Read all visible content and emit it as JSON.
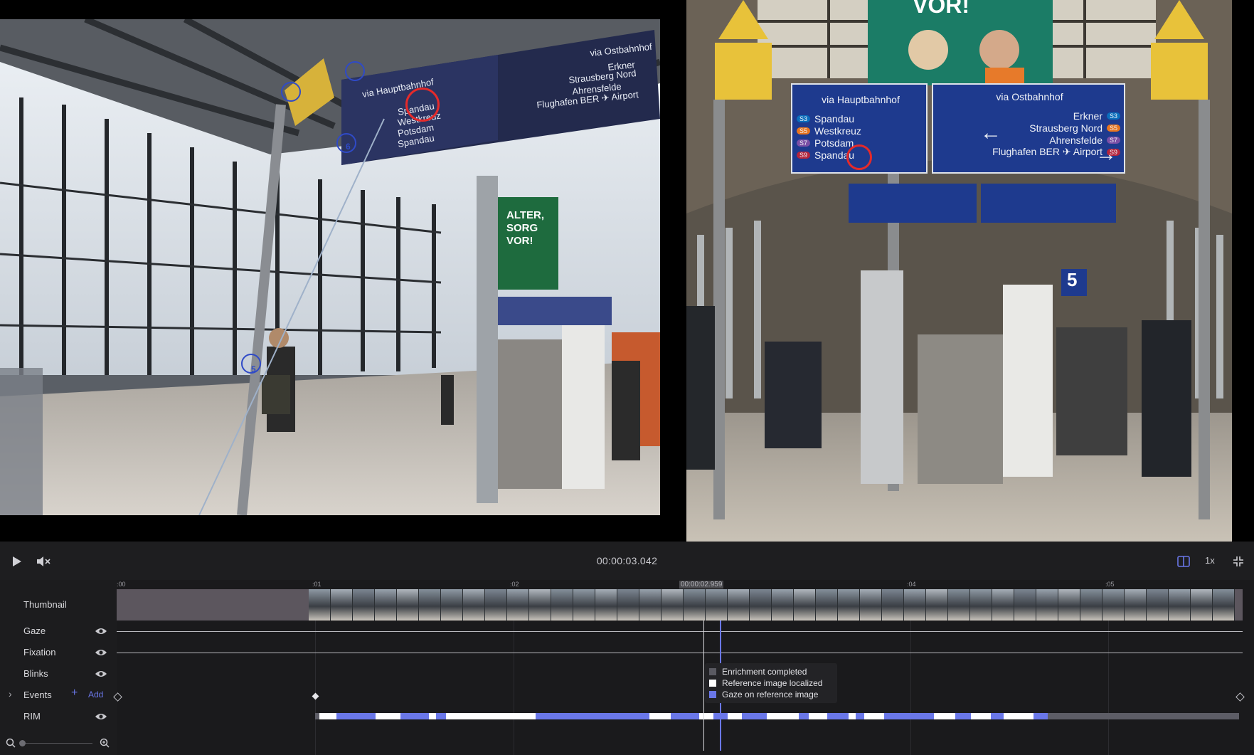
{
  "left_video": {
    "sign_header": "via Hauptbahnhof",
    "sign_lines": [
      "Spandau",
      "Westkreuz",
      "Potsdam",
      "Spandau"
    ],
    "sign_right": [
      "via Ostbahnhof",
      "Erkner",
      "Strausberg Nord",
      "Ahrensfelde",
      "Flughafen BER ✈ Airport"
    ],
    "poster_text": "ALTER, SORG VOR!",
    "fixation_numbers": [
      "6",
      "5"
    ]
  },
  "right_video": {
    "sign_left_header": "via Hauptbahnhof",
    "sign_left_lines": [
      {
        "badge": "S3",
        "name": "Spandau",
        "color": "#0a6ebd"
      },
      {
        "badge": "S5",
        "name": "Westkreuz",
        "color": "#e8741e"
      },
      {
        "badge": "S7",
        "name": "Potsdam",
        "color": "#7b4fa6"
      },
      {
        "badge": "S9",
        "name": "Spandau",
        "color": "#b5243c"
      }
    ],
    "sign_right_header": "via Ostbahnhof",
    "sign_right_lines": [
      {
        "badge": "S3",
        "name": "Erkner",
        "color": "#0a6ebd"
      },
      {
        "badge": "S5",
        "name": "Strausberg Nord",
        "color": "#e8741e"
      },
      {
        "badge": "S7",
        "name": "Ahrensfelde",
        "color": "#7b4fa6"
      },
      {
        "badge": "S9",
        "name": "Flughafen BER ✈ Airport",
        "color": "#b5243c"
      }
    ],
    "platform_number": "5",
    "banner_text": "VOR!"
  },
  "controls": {
    "timecode": "00:00:03.042",
    "speed": "1x",
    "icons": [
      "play-icon",
      "mute-icon",
      "split-view-icon",
      "collapse-icon"
    ]
  },
  "timeline": {
    "ticks": [
      ":00",
      ":01",
      ":02",
      ":04",
      ":05"
    ],
    "cursor_time": "00:00:02.959",
    "tracks": {
      "thumbnail": "Thumbnail",
      "gaze": "Gaze",
      "fixation": "Fixation",
      "blinks": "Blinks",
      "events": "Events",
      "rim": "RIM"
    },
    "add_label": "Add",
    "legend": [
      {
        "label": "Enrichment completed",
        "color": "#5a5a62"
      },
      {
        "label": "Reference image localized",
        "color": "#ffffff"
      },
      {
        "label": "Gaze on reference image",
        "color": "#6a77e8"
      }
    ],
    "accent_color": "#6a77e8"
  }
}
